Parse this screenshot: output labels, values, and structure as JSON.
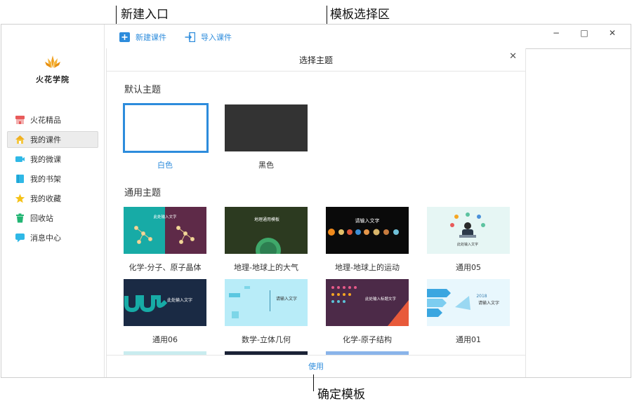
{
  "annotations": {
    "new_entry": "新建入口",
    "template_area": "模板选择区",
    "confirm_template": "确定模板"
  },
  "app": {
    "logo_text": "火花学院"
  },
  "toolbar": {
    "new_label": "新建课件",
    "import_label": "导入课件"
  },
  "sidebar": {
    "items": [
      {
        "label": "火花精品",
        "icon": "shop-icon",
        "active": false
      },
      {
        "label": "我的课件",
        "icon": "home-icon",
        "active": true
      },
      {
        "label": "我的微课",
        "icon": "video-icon",
        "active": false
      },
      {
        "label": "我的书架",
        "icon": "book-icon",
        "active": false
      },
      {
        "label": "我的收藏",
        "icon": "star-icon",
        "active": false
      },
      {
        "label": "回收站",
        "icon": "trash-icon",
        "active": false
      },
      {
        "label": "消息中心",
        "icon": "message-icon",
        "active": false
      }
    ]
  },
  "window_controls": {
    "minimize": "−",
    "maximize": "□",
    "close": "✕"
  },
  "modal": {
    "title": "选择主题",
    "close": "✕",
    "default_section": "默认主题",
    "general_section": "通用主题",
    "use_button": "使用",
    "default_themes": [
      {
        "label": "白色",
        "selected": true
      },
      {
        "label": "黑色",
        "selected": false
      }
    ],
    "general_themes": [
      {
        "label": "化学-分子、原子晶体",
        "thumb_text": "此处输入文字"
      },
      {
        "label": "地理-地球上的大气",
        "thumb_text": "地理通用模板"
      },
      {
        "label": "地理-地球上的运动",
        "thumb_text": "请输入文字"
      },
      {
        "label": "通用05",
        "thumb_text": "此处输入文字"
      },
      {
        "label": "通用06",
        "thumb_text": "此处输入文字"
      },
      {
        "label": "数学-立体几何",
        "thumb_text": "请输入文字"
      },
      {
        "label": "化学-原子结构",
        "thumb_text": "此处输入标题文字"
      },
      {
        "label": "通用01",
        "thumb_text": "请输入文字",
        "thumb_year": "2018"
      }
    ]
  },
  "colors": {
    "accent": "#2d8cdc",
    "logo": "#f0a020"
  }
}
